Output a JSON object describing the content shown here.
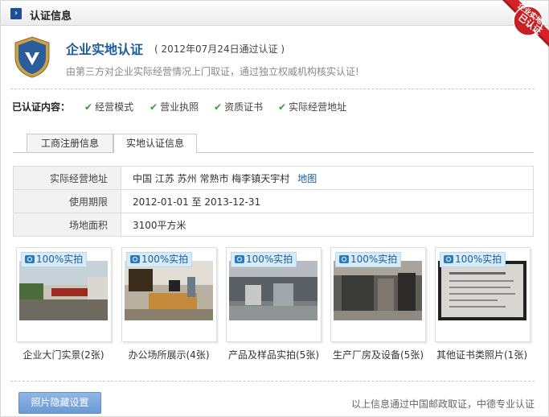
{
  "header": {
    "title": "认证信息"
  },
  "ribbon": {
    "line1": "企业实地",
    "line2": "已认证"
  },
  "cert": {
    "title": "企业实地认证",
    "date": "( 2012年07月24日通过认证 )",
    "desc": "由第三方对企业实际经营情况上门取证，通过独立权威机构核实认证!"
  },
  "verified": {
    "label": "已认证内容：",
    "items": [
      "经营模式",
      "营业执照",
      "资质证书",
      "实际经营地址"
    ]
  },
  "tabs": [
    {
      "label": "工商注册信息"
    },
    {
      "label": "实地认证信息",
      "active": true
    }
  ],
  "info": {
    "rows": [
      {
        "key": "实际经营地址",
        "value": "中国 江苏 苏州 常熟市 梅李镇天宇村",
        "link": "地图"
      },
      {
        "key": "使用期限",
        "value": "2012-01-01 至 2013-12-31"
      },
      {
        "key": "场地面积",
        "value": "3100平方米"
      }
    ]
  },
  "photos": {
    "badge": "100%实拍",
    "items": [
      {
        "caption": "企业大门实景(2张)"
      },
      {
        "caption": "办公场所展示(4张)"
      },
      {
        "caption": "产品及样品实拍(5张)"
      },
      {
        "caption": "生产厂房及设备(5张)"
      },
      {
        "caption": "其他证书类照片(1张)"
      }
    ]
  },
  "actions": {
    "photo_settings": "照片隐藏设置"
  },
  "footer": {
    "note": "以上信息通过中国邮政取证，中德专业认证"
  }
}
